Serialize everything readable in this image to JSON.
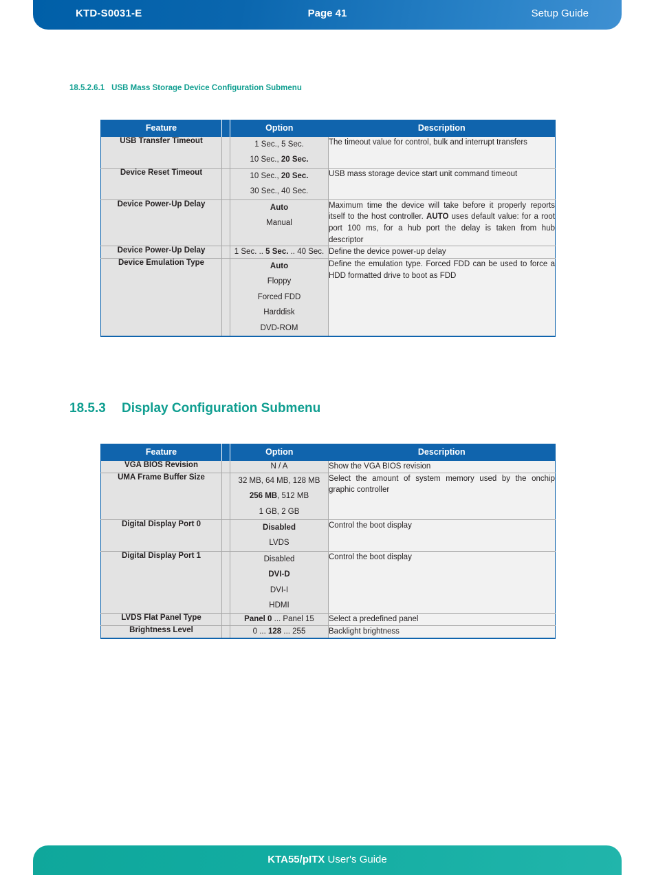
{
  "header": {
    "doc_id": "KTD-S0031-E",
    "page_label": "Page 41",
    "doc_type": "Setup Guide"
  },
  "footer": {
    "product": "KTA55/pITX",
    "guide_label": " User's Guide"
  },
  "sub_heading": {
    "number": "18.5.2.6.1",
    "title": "USB Mass Storage Device Configuration Submenu"
  },
  "main_heading": {
    "number": "18.5.3",
    "title": "Display Configuration Submenu"
  },
  "table_usb": {
    "columns": [
      "Feature",
      "Option",
      "Description"
    ],
    "rows": [
      {
        "feature": "USB Transfer Timeout",
        "options": [
          "1 Sec., 5 Sec.",
          "10 Sec., 20 Sec."
        ],
        "description": "The timeout value for control, bulk and interrupt transfers"
      },
      {
        "feature": "Device Reset Timeout",
        "options": [
          "10 Sec., 20 Sec.",
          "30 Sec., 40 Sec."
        ],
        "description": "USB mass storage device start unit command timeout"
      },
      {
        "feature": "Device Power-Up Delay",
        "options": [
          "Auto",
          "Manual"
        ],
        "description": "Maximum time the device will take before it properly reports itself to the host controller. AUTO uses default value: for a root port 100 ms, for a hub port the delay is taken from hub descriptor"
      },
      {
        "feature": "Device Power-Up Delay",
        "options": [
          "1 Sec. .. 5 Sec. .. 40 Sec."
        ],
        "description": "Define the device power-up delay"
      },
      {
        "feature": "Device Emulation Type",
        "options": [
          "Auto",
          "Floppy",
          "Forced FDD",
          "Harddisk",
          "DVD-ROM"
        ],
        "description": "Define the emulation type. Forced FDD can be used to force a HDD formatted drive to boot as FDD"
      }
    ]
  },
  "table_display": {
    "columns": [
      "Feature",
      "Option",
      "Description"
    ],
    "rows": [
      {
        "feature": "VGA BIOS Revision",
        "options": [
          "N / A"
        ],
        "description": "Show the VGA BIOS revision"
      },
      {
        "feature": "UMA Frame Buffer Size",
        "options": [
          "32 MB, 64 MB, 128 MB",
          "256 MB, 512 MB",
          "1 GB, 2 GB"
        ],
        "description": "Select the amount of system memory used by the onchip graphic controller"
      },
      {
        "feature": "Digital Display Port 0",
        "options": [
          "Disabled",
          "LVDS"
        ],
        "description": "Control the boot display"
      },
      {
        "feature": "Digital Display Port 1",
        "options": [
          "Disabled",
          "DVI-D",
          "DVI-I",
          "HDMI"
        ],
        "description": "Control the boot display"
      },
      {
        "feature": "LVDS Flat Panel Type",
        "options": [
          "Panel 0 ... Panel 15"
        ],
        "description": "Select a predefined panel"
      },
      {
        "feature": "Brightness Level",
        "options": [
          "0 ... 128 ... 255"
        ],
        "description": "Backlight brightness"
      }
    ]
  },
  "colors": {
    "header_blue": "#1064ad",
    "footer_teal": "#12aca1",
    "heading_teal": "#0f9e90",
    "feature_text_blue": "#1064ad",
    "row_gray": "#e3e3e3",
    "desc_gray": "#f2f2f2"
  }
}
